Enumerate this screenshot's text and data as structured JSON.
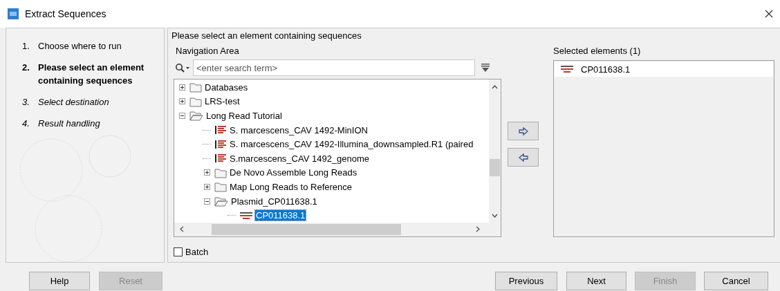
{
  "window": {
    "title": "Extract Sequences"
  },
  "steps": [
    {
      "number": "1.",
      "label": "Choose where to run",
      "current": false,
      "reached": true
    },
    {
      "number": "2.",
      "label": "Please select an element containing sequences",
      "current": true,
      "reached": true
    },
    {
      "number": "3.",
      "label": "Select destination",
      "current": false,
      "reached": false
    },
    {
      "number": "4.",
      "label": "Result handling",
      "current": false,
      "reached": false
    }
  ],
  "instruction": "Please select an element containing sequences",
  "navigation": {
    "label": "Navigation Area",
    "search": {
      "placeholder": "<enter search term>"
    },
    "tree": [
      {
        "label": "Databases",
        "kind": "folder",
        "expanded": false,
        "selected": false
      },
      {
        "label": "LRS-test",
        "kind": "folder",
        "expanded": false,
        "selected": false
      },
      {
        "label": "Long Read Tutorial",
        "kind": "folder",
        "expanded": true,
        "selected": false,
        "children": [
          {
            "label": "S. marcescens_CAV 1492-MinION",
            "kind": "reads",
            "selected": false
          },
          {
            "label": "S. marcescens_CAV 1492-Illumina_downsampled.R1 (paired",
            "kind": "reads",
            "selected": false
          },
          {
            "label": "S.marcescens_CAV 1492_genome",
            "kind": "reads",
            "selected": false
          },
          {
            "label": "De Novo Assemble Long Reads",
            "kind": "folder",
            "expanded": false,
            "selected": false
          },
          {
            "label": "Map Long Reads to Reference",
            "kind": "folder",
            "expanded": false,
            "selected": false
          },
          {
            "label": "Plasmid_CP011638.1",
            "kind": "folder",
            "expanded": true,
            "selected": false,
            "children": [
              {
                "label": "CP011638.1",
                "kind": "sequence",
                "selected": true
              }
            ]
          }
        ]
      }
    ]
  },
  "batch": {
    "label": "Batch",
    "checked": false
  },
  "selected_elements": {
    "label": "Selected elements (1)",
    "items": [
      {
        "label": "CP011638.1",
        "kind": "sequence"
      }
    ]
  },
  "buttons": [
    {
      "label": "Help",
      "disabled": false
    },
    {
      "label": "Reset",
      "disabled": true
    },
    {
      "label": "Previous",
      "disabled": false
    },
    {
      "label": "Next",
      "disabled": false
    },
    {
      "label": "Finish",
      "disabled": true
    },
    {
      "label": "Cancel",
      "disabled": false
    }
  ]
}
